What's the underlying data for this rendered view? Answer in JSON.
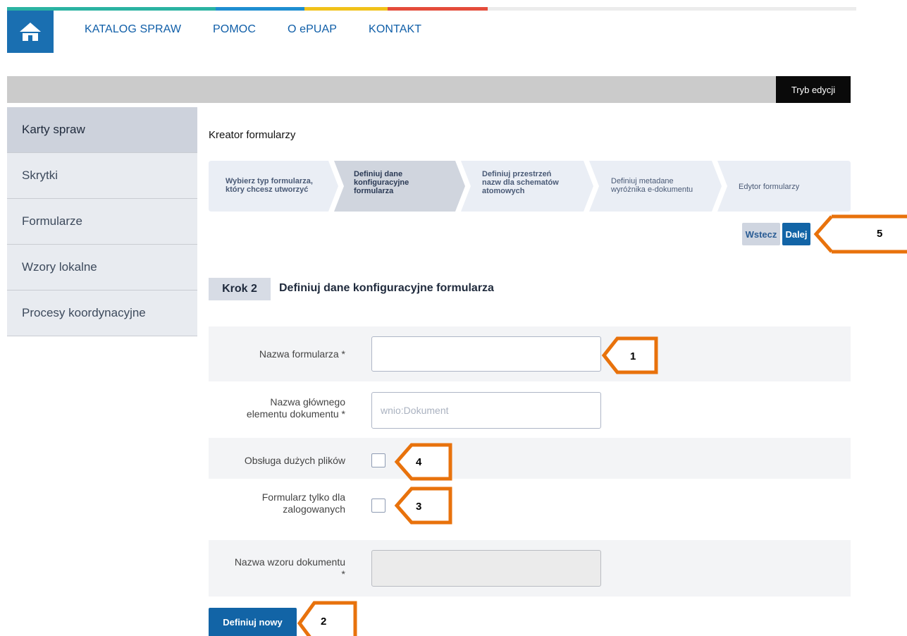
{
  "nav": {
    "home_icon": "home-icon",
    "items": [
      "KATALOG SPRAW",
      "POMOC",
      "O ePUAP",
      "KONTAKT"
    ]
  },
  "edit_mode_label": "Tryb edycji",
  "sidebar": {
    "items": [
      {
        "label": "Karty spraw",
        "active": true
      },
      {
        "label": "Skrytki"
      },
      {
        "label": "Formularze"
      },
      {
        "label": "Wzory lokalne"
      },
      {
        "label": "Procesy koordynacyjne"
      }
    ]
  },
  "page_title": "Kreator formularzy",
  "wizard": {
    "steps": [
      [
        "Wybierz typ formularza,",
        "który chcesz utworzyć"
      ],
      [
        "Definiuj dane",
        "konfiguracyjne",
        "formularza"
      ],
      [
        "Definiuj przestrzeń",
        "nazw dla schematów",
        "atomowych"
      ],
      [
        "Definiuj metadane",
        "wyróżnika e-dokumentu"
      ],
      [
        "Edytor formularzy"
      ]
    ],
    "active_step": 2
  },
  "buttons": {
    "back": "Wstecz",
    "next": "Dalej",
    "define_new": "Definiuj nowy"
  },
  "step": {
    "number": "Krok 2",
    "heading": "Definiuj dane konfiguracyjne formularza"
  },
  "form": {
    "form_name_label": "Nazwa formularza *",
    "form_name_value": "",
    "root_element_label_line1": "Nazwa głównego",
    "root_element_label_line2": "elementu dokumentu *",
    "root_element_placeholder": "wnio:Dokument",
    "large_files_label": "Obsługa dużych plików",
    "large_files_checked": false,
    "logged_only_label_line1": "Formularz tylko dla",
    "logged_only_label_line2": "zalogowanych",
    "logged_only_checked": false,
    "template_name_label_line1": "Nazwa wzoru dokumentu",
    "template_name_label_line2": "*",
    "template_name_value": ""
  },
  "callouts": [
    "1",
    "2",
    "3",
    "4",
    "5"
  ],
  "colors": {
    "brand_blue": "#1264a6",
    "callout_orange": "#e8720c",
    "stripe": [
      "#2ab3a2",
      "#1f8ed1",
      "#f1c21a",
      "#e44c3b"
    ]
  }
}
